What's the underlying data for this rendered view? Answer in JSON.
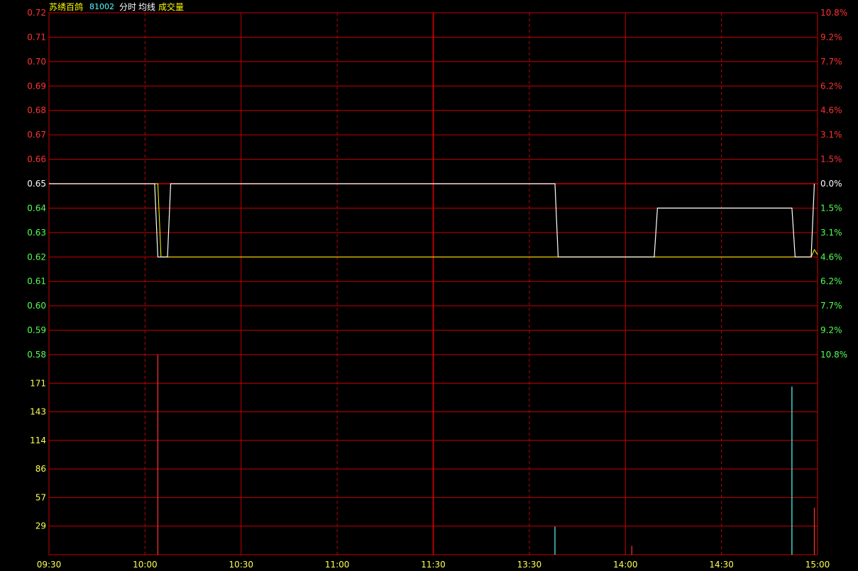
{
  "header": {
    "name": "苏绣百鸽",
    "code": "81002",
    "labels": [
      "分时",
      "均线",
      "成交量"
    ]
  },
  "colors": {
    "background": "#000000",
    "grid": "#c80000",
    "up": "#ff3232",
    "down": "#54ff54",
    "neutral": "#ffffff",
    "volume_axis": "#ffff54",
    "price_line": "#ffffff",
    "avg_line": "#ffff00",
    "down_volume": "#54ffff",
    "header_name": "#ffff00",
    "header_code": "#54ffff"
  },
  "chart_data": {
    "type": "line",
    "prev_close": 0.65,
    "price_axis": {
      "ylim": [
        0.58,
        0.72
      ],
      "ticks": [
        "0.72",
        "0.71",
        "0.70",
        "0.69",
        "0.68",
        "0.67",
        "0.66",
        "0.65",
        "0.64",
        "0.63",
        "0.62",
        "0.61",
        "0.60",
        "0.59",
        "0.58"
      ]
    },
    "pct_axis": {
      "ticks": [
        "10.8%",
        "9.2%",
        "7.7%",
        "6.2%",
        "4.6%",
        "3.1%",
        "1.5%",
        "0.0%",
        "1.5%",
        "3.1%",
        "4.6%",
        "6.2%",
        "7.7%",
        "9.2%",
        "10.8%"
      ]
    },
    "volume_axis": {
      "ylim": [
        0,
        200
      ],
      "ticks": [
        "171",
        "143",
        "114",
        "86",
        "57",
        "29"
      ]
    },
    "x_labels": [
      "09:30",
      "10:00",
      "10:30",
      "11:00",
      "11:30",
      "13:30",
      "14:00",
      "14:30",
      "15:00"
    ],
    "total_minutes": 240,
    "price_series": {
      "name": "分时",
      "points": [
        [
          0,
          0.65
        ],
        [
          33,
          0.65
        ],
        [
          34,
          0.62
        ],
        [
          37,
          0.62
        ],
        [
          38,
          0.65
        ],
        [
          158,
          0.65
        ],
        [
          159,
          0.62
        ],
        [
          189,
          0.62
        ],
        [
          190,
          0.64
        ],
        [
          232,
          0.64
        ],
        [
          233,
          0.62
        ],
        [
          238,
          0.62
        ],
        [
          239,
          0.65
        ]
      ]
    },
    "avg_series": {
      "name": "均线",
      "points": [
        [
          0,
          0.65
        ],
        [
          34,
          0.65
        ],
        [
          35,
          0.62
        ],
        [
          238,
          0.62
        ],
        [
          239,
          0.623
        ],
        [
          240,
          0.621
        ]
      ]
    },
    "volume_series": {
      "name": "成交量",
      "bars": [
        {
          "t": 34,
          "v": 200,
          "dir": "up"
        },
        {
          "t": 158,
          "v": 28,
          "dir": "down"
        },
        {
          "t": 182,
          "v": 9,
          "dir": "up"
        },
        {
          "t": 232,
          "v": 168,
          "dir": "down"
        },
        {
          "t": 239,
          "v": 47,
          "dir": "up"
        }
      ]
    }
  }
}
